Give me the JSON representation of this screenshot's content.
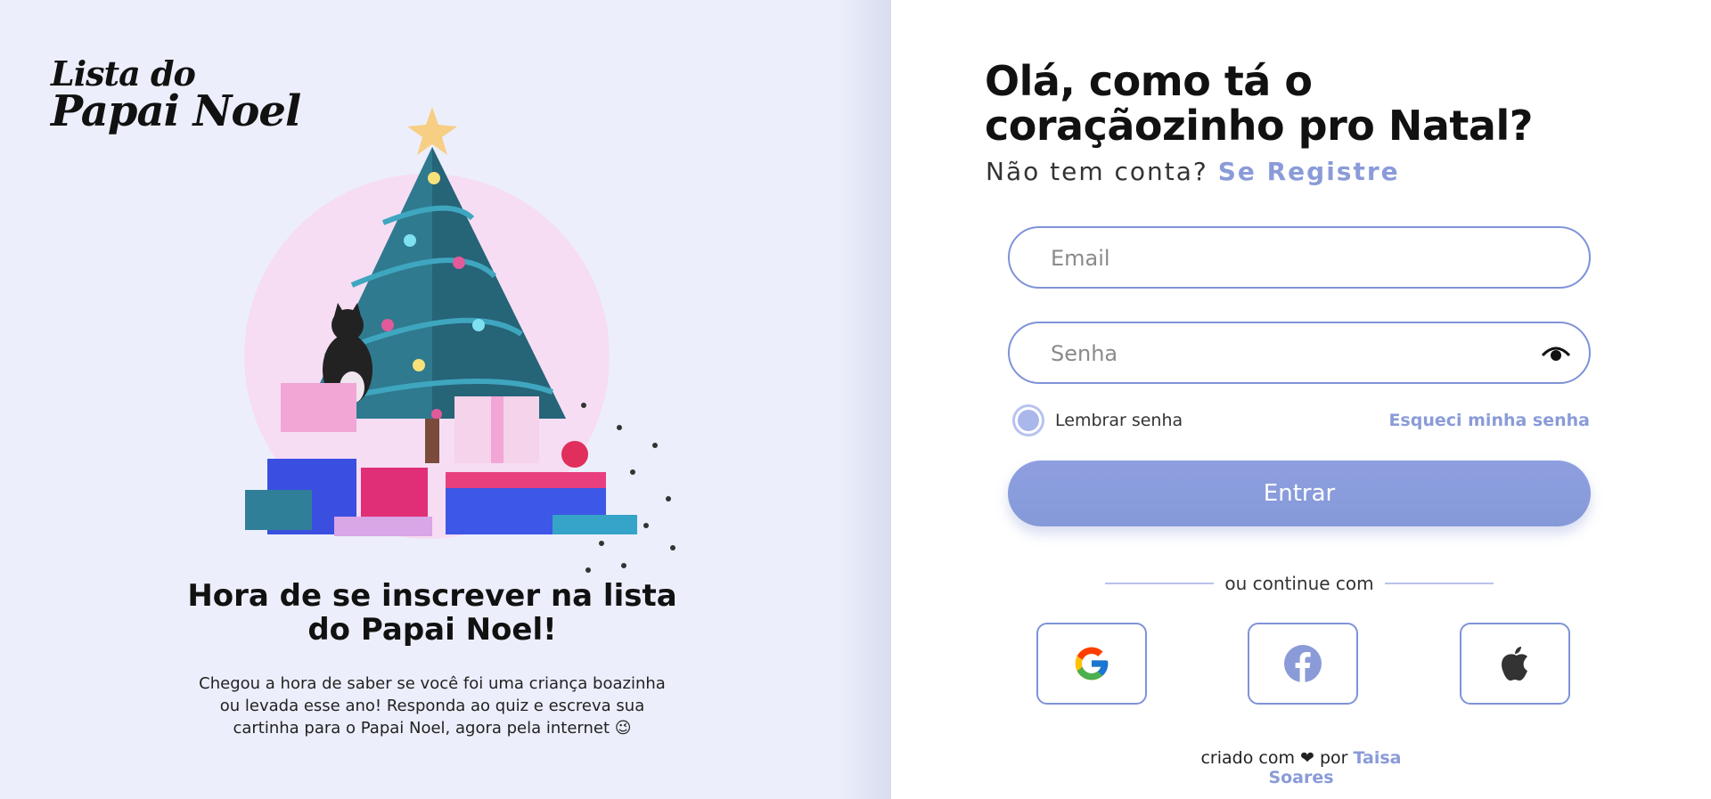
{
  "logo": {
    "line1": "Lista do",
    "line2": "Papai Noel"
  },
  "left": {
    "title": "Hora de se inscrever na lista do Papai Noel!",
    "description": "Chegou a hora de saber se você foi uma criança boazinha ou levada esse ano! Responda ao quiz e escreva sua cartinha para o Papai Noel, agora pela internet 😉"
  },
  "login": {
    "headline": "Olá, como tá o coraçãozinho pro Natal?",
    "no_account": "Não tem conta?",
    "register_link": "Se Registre",
    "email_placeholder": "Email",
    "password_placeholder": "Senha",
    "remember_label": "Lembrar senha",
    "forgot_link": "Esqueci minha senha",
    "submit_label": "Entrar",
    "divider_text": "ou continue com"
  },
  "social": [
    {
      "icon": "google-icon"
    },
    {
      "icon": "facebook-icon"
    },
    {
      "icon": "apple-icon"
    }
  ],
  "footer": {
    "prefix": "criado com",
    "heart": "❤",
    "by": "por",
    "author": "Taisa Soares"
  },
  "colors": {
    "accent": "#8a9bd8",
    "border": "#7f93d8",
    "left_bg": "#eceffb"
  }
}
